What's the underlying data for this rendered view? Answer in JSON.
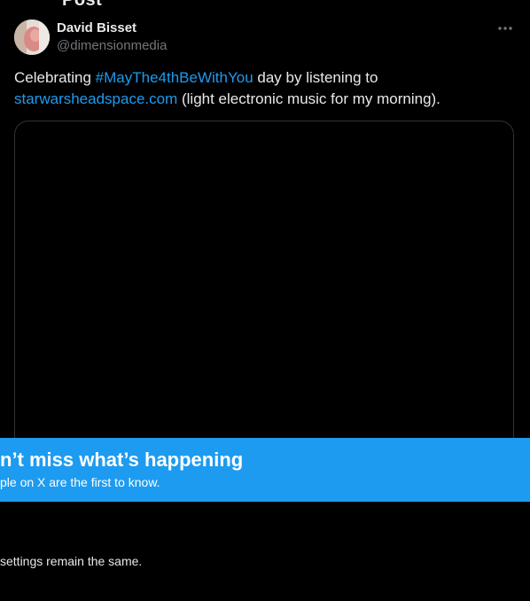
{
  "page_header": {
    "title_fragment": "Post"
  },
  "tweet": {
    "author_name": "David Bisset",
    "author_handle": "@dimensionmedia",
    "text_part1": "Celebrating ",
    "hashtag": "#MayThe4thBeWithYou",
    "text_part2": " day by listening to ",
    "link": "starwarsheadspace.com",
    "text_part3": " (light electronic music for my morning).",
    "more_icon": "more-horizontal-icon"
  },
  "banner": {
    "title": "n’t miss what’s happening",
    "subtitle": "ple on X are the first to know.",
    "color": "#1d9bf0"
  },
  "footer_note": "settings remain the same.",
  "colors": {
    "background": "#000000",
    "text": "#e7e9ea",
    "muted": "#71767b",
    "accent": "#1d9bf0",
    "border": "#2f3336"
  }
}
